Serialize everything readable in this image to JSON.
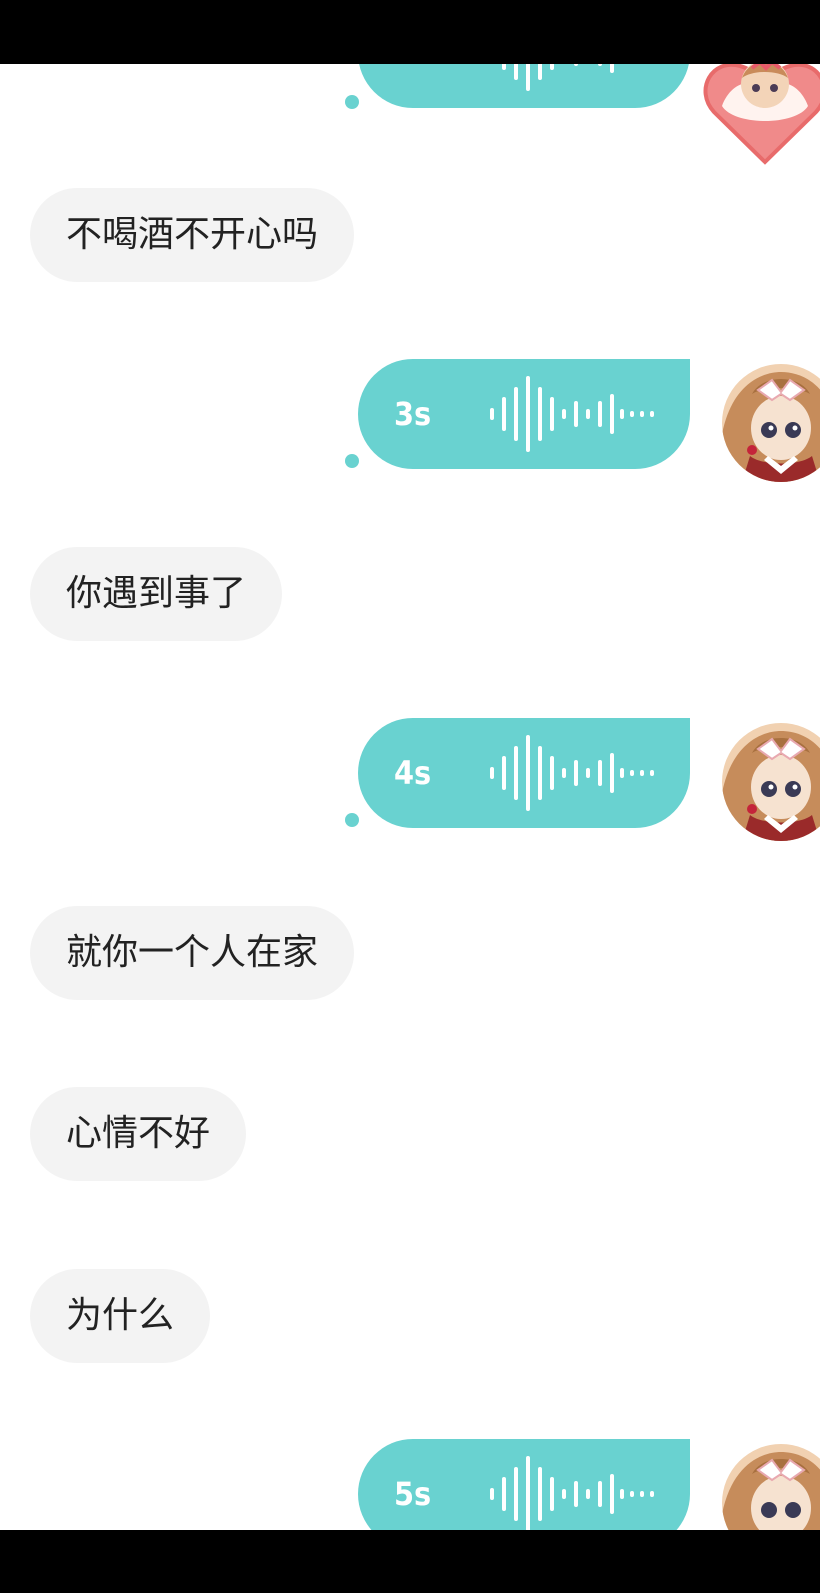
{
  "colors": {
    "accent": "#69d2d0",
    "incoming_bubble": "#f3f3f3",
    "text": "#222222"
  },
  "messages": [
    {
      "type": "voice",
      "side": "right",
      "duration": ""
    },
    {
      "type": "text",
      "side": "left",
      "text": "不喝酒不开心吗"
    },
    {
      "type": "voice",
      "side": "right",
      "duration": "3s"
    },
    {
      "type": "text",
      "side": "left",
      "text": "你遇到事了"
    },
    {
      "type": "voice",
      "side": "right",
      "duration": "4s"
    },
    {
      "type": "text",
      "side": "left",
      "text": "就你一个人在家"
    },
    {
      "type": "text",
      "side": "left",
      "text": "心情不好"
    },
    {
      "type": "text",
      "side": "left",
      "text": "为什么"
    },
    {
      "type": "voice",
      "side": "right",
      "duration": "5s"
    }
  ],
  "icons": {
    "voice_wave": "sound-wave-icon",
    "avatar": "user-avatar"
  }
}
